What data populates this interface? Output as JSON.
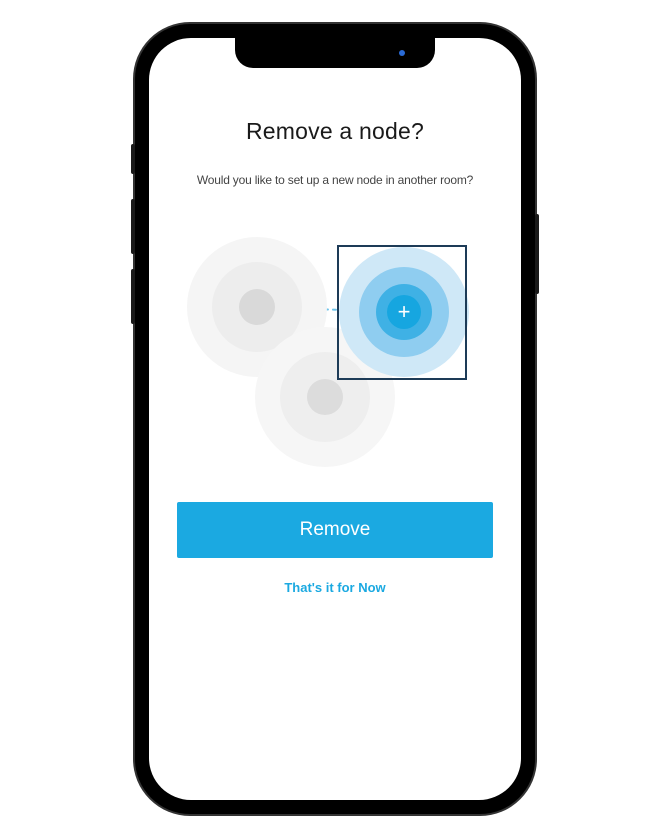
{
  "screen": {
    "title": "Remove a node?",
    "subtitle": "Would you like to set up a new node in another room?",
    "primary_button_label": "Remove",
    "secondary_link_label": "That's it for Now"
  },
  "diagram": {
    "existing_nodes": 2,
    "new_node_highlighted": true,
    "add_symbol": "+"
  },
  "colors": {
    "accent": "#1ba9e1",
    "highlight_border": "#1d3b57",
    "node_inactive": "#d9d9d9"
  }
}
